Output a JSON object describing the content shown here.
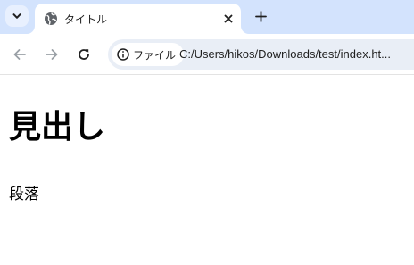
{
  "tab": {
    "title": "タイトル"
  },
  "omnibox": {
    "chip_label": "ファイル",
    "url": "C:/Users/hikos/Downloads/test/index.ht..."
  },
  "page": {
    "heading": "見出し",
    "paragraph": "段落"
  },
  "icons": {
    "tab_search": "chevron-down-icon",
    "favicon": "globe-icon",
    "tab_close": "close-icon",
    "new_tab": "plus-icon",
    "back": "arrow-left-icon",
    "forward": "arrow-right-icon",
    "reload": "reload-icon",
    "site_info": "info-icon"
  },
  "colors": {
    "tabstrip_bg": "#d3e3fd",
    "omnibox_bg": "#e9eef6",
    "disabled_nav": "#9aa0a6"
  }
}
